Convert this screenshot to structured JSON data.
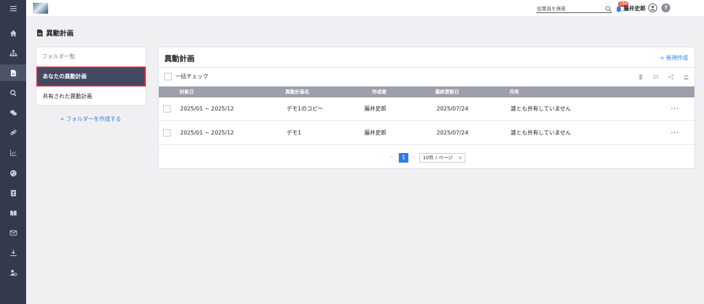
{
  "nav": {
    "items": [
      {
        "name": "menu-icon",
        "active": false
      },
      {
        "name": "home-icon",
        "active": false
      },
      {
        "name": "org-chart-icon",
        "active": false
      },
      {
        "name": "document-icon",
        "active": true
      },
      {
        "name": "search-icon",
        "active": false
      },
      {
        "name": "chat-icon",
        "active": false
      },
      {
        "name": "link-icon",
        "active": false
      },
      {
        "name": "chart-icon",
        "active": false
      },
      {
        "name": "globe-icon",
        "active": false
      },
      {
        "name": "contact-card-icon",
        "active": false
      },
      {
        "name": "book-icon",
        "active": false
      },
      {
        "name": "mail-icon",
        "active": false
      },
      {
        "name": "download-icon",
        "active": false
      },
      {
        "name": "user-settings-icon",
        "active": false
      }
    ]
  },
  "header": {
    "search_placeholder": "従業員を検索",
    "notification_count": "286",
    "user_name": "藤井史郎",
    "help_label": "?"
  },
  "page": {
    "title": "異動計画"
  },
  "folders": {
    "header": "フォルダ一覧",
    "items": [
      {
        "label": "あなたの異動計画",
        "active": true
      },
      {
        "label": "共有された異動計画",
        "active": false
      }
    ],
    "create_label": "+ フォルダーを作成する"
  },
  "main": {
    "title": "異動計画",
    "new_label": "+ 新規作成",
    "bulk_check_label": "一括チェック",
    "toolbar_icons": [
      "trash-icon",
      "swap-icon",
      "share-icon",
      "people-icon"
    ],
    "columns": [
      "対象日",
      "異動計画名",
      "作成者",
      "最終更新日",
      "共有"
    ],
    "rows": [
      {
        "period": "2025/01 ~ 2025/12",
        "name": "デモ1のコピー",
        "creator": "藤井史郎",
        "updated": "2025/07/24",
        "shared": "誰とも共有していません",
        "more": "···"
      },
      {
        "period": "2025/01 ~ 2025/12",
        "name": "デモ1",
        "creator": "藤井史郎",
        "updated": "2025/07/24",
        "shared": "誰とも共有していません",
        "more": "···"
      }
    ],
    "pagination": {
      "current_page": "1",
      "page_size_label": "10件 / ページ"
    }
  },
  "colors": {
    "nav_bg": "#333a4d",
    "accent": "#2f7de1",
    "active_folder_bg": "#414a60",
    "highlight_border": "#e0262c",
    "table_header_bg": "#9da0ab",
    "badge": "#e5533d"
  }
}
